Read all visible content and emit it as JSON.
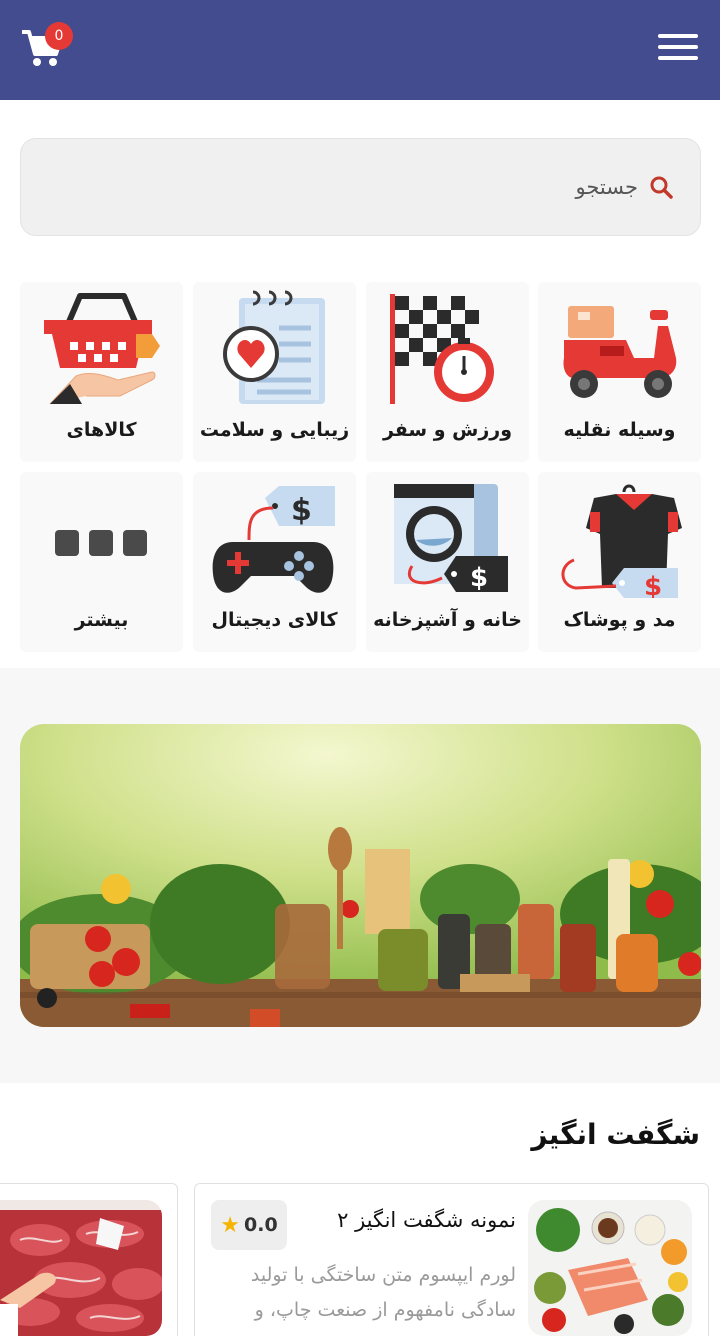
{
  "header": {
    "cart_count": "0",
    "icons": {
      "cart": "shopping-cart-icon",
      "menu": "hamburger-menu-icon"
    },
    "brand_color": "#434c8e",
    "badge_color": "#e53935"
  },
  "search": {
    "placeholder": "جستجو",
    "icon": "search-icon",
    "icon_color": "#c0392b"
  },
  "categories": [
    {
      "label": "وسیله نقلیه",
      "icon": "scooter-icon"
    },
    {
      "label": "ورزش و سفر",
      "icon": "race-flag-clock-icon"
    },
    {
      "label": "زیبایی و سلامت",
      "icon": "health-notepad-icon"
    },
    {
      "label": "کالاهای",
      "icon": "shopping-basket-icon"
    },
    {
      "label": "مد و پوشاک",
      "icon": "shirt-price-tag-icon"
    },
    {
      "label": "خانه و آشپزخانه",
      "icon": "washing-machine-icon"
    },
    {
      "label": "کالای دیجیتال",
      "icon": "gamepad-icon"
    },
    {
      "label": "بیشتر",
      "icon": "more-dots-icon"
    }
  ],
  "banner": {
    "image": "vegetables-groceries-banner",
    "slides_indicator": 1
  },
  "section": {
    "title": "شگفت انگیز",
    "products": [
      {
        "title": "نمونه شگفت انگیز ۲",
        "rating": "0.0",
        "description": "لورم ایپسوم متن ساختگی با تولید سادگی نامفهوم از صنعت چاپ، و",
        "image": "healthy-food-bowls"
      },
      {
        "image": "raw-meat-market"
      }
    ]
  }
}
